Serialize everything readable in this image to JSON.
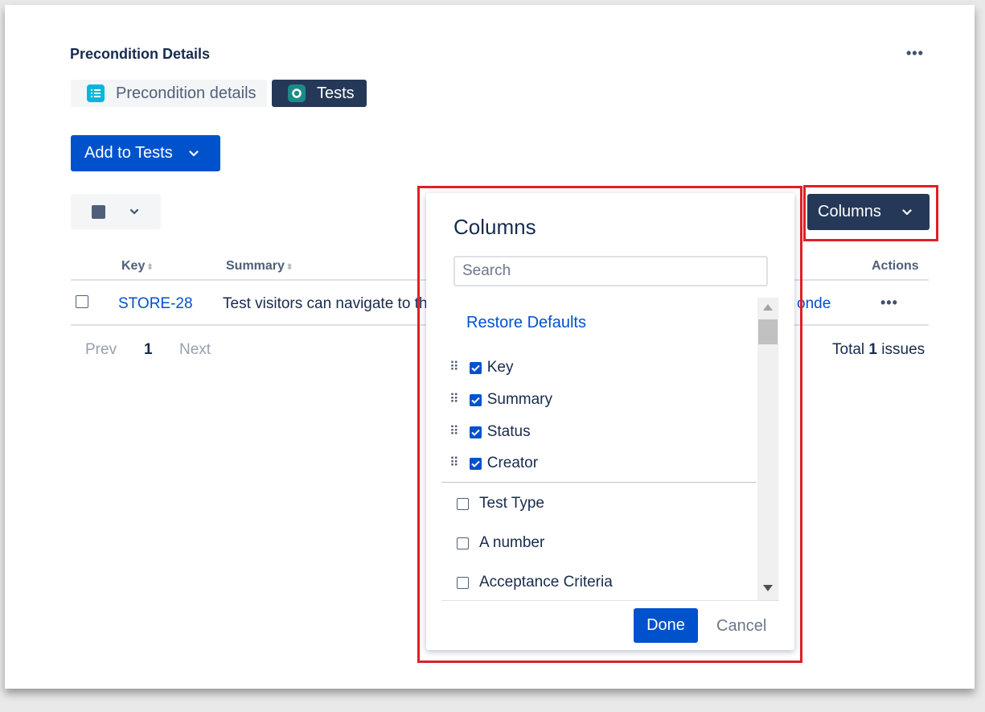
{
  "page": {
    "title": "Precondition Details",
    "more_icon": "more-icon"
  },
  "tabs": [
    {
      "label": "Precondition details",
      "icon": "list-icon"
    },
    {
      "label": "Tests",
      "icon": "test-icon",
      "active": true
    }
  ],
  "toolbar": {
    "add_button_label": "Add to Tests",
    "columns_button_label": "Columns"
  },
  "table": {
    "headers": [
      "Key",
      "Summary",
      "Actions"
    ],
    "rows": [
      {
        "key": "STORE-28",
        "summary": "Test visitors can navigate to th",
        "creator_partial": "onde"
      }
    ]
  },
  "pagination": {
    "prev": "Prev",
    "current": "1",
    "next": "Next",
    "total_prefix": "Total",
    "total_count": "1",
    "total_suffix": "issues"
  },
  "columns_popup": {
    "title": "Columns",
    "search_placeholder": "Search",
    "restore_label": "Restore Defaults",
    "selected_items": [
      "Key",
      "Summary",
      "Status",
      "Creator"
    ],
    "unselected_items": [
      "Test Type",
      "A number",
      "Acceptance Criteria"
    ],
    "done_label": "Done",
    "cancel_label": "Cancel"
  },
  "colors": {
    "primary": "#0052cc",
    "dark": "#253858",
    "highlight": "#e01f26"
  }
}
